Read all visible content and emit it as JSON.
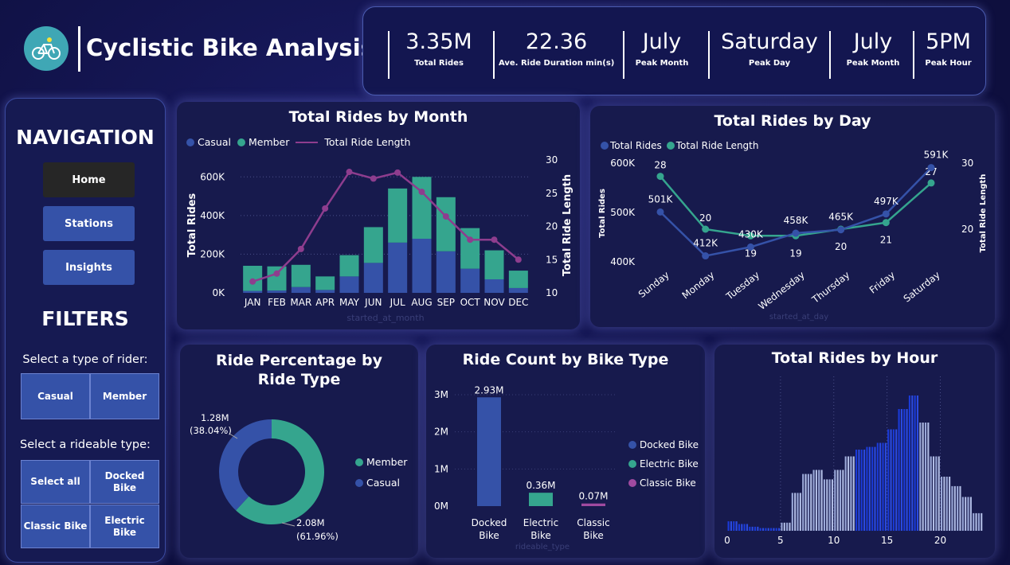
{
  "header": {
    "title": "Cyclistic Bike Analysis",
    "kpis": [
      {
        "value": "3.35M",
        "label": "Total Rides"
      },
      {
        "value": "22.36",
        "label": "Ave. Ride Duration min(s)"
      },
      {
        "value": "July",
        "label": "Peak Month"
      },
      {
        "value": "Saturday",
        "label": "Peak Day"
      },
      {
        "value": "July",
        "label": "Peak Month"
      },
      {
        "value": "5PM",
        "label": "Peak Hour"
      }
    ]
  },
  "navigation": {
    "heading": "NAVIGATION",
    "buttons": [
      "Home",
      "Stations",
      "Insights"
    ],
    "active": "Home"
  },
  "filters": {
    "heading": "FILTERS",
    "rider_label": "Select a type of rider:",
    "rider_options": [
      "Casual",
      "Member"
    ],
    "rideable_label": "Select a rideable type:",
    "rideable_options": [
      "Select all",
      "Docked Bike",
      "Classic Bike",
      "Electric Bike"
    ]
  },
  "colors": {
    "casual": "#3552a8",
    "member": "#35a58e",
    "ride_length": "#8e3d8e",
    "classic": "#a04aa0",
    "hour_dark": "#1a3ad8",
    "hour_light": "#9aa8d8"
  },
  "chart_data": [
    {
      "type": "bar",
      "title": "Total Rides by Month",
      "xlabel": "started_at_month",
      "ylabel": "Total Rides",
      "y2label": "Total Ride Length",
      "categories": [
        "JAN",
        "FEB",
        "MAR",
        "APR",
        "MAY",
        "JUN",
        "JUL",
        "AUG",
        "SEP",
        "OCT",
        "NOV",
        "DEC"
      ],
      "series": [
        {
          "name": "Casual",
          "values": [
            10000,
            12000,
            30000,
            15000,
            85000,
            155000,
            260000,
            280000,
            215000,
            125000,
            70000,
            25000
          ]
        },
        {
          "name": "Member",
          "values": [
            130000,
            125000,
            115000,
            70000,
            110000,
            185000,
            280000,
            320000,
            280000,
            210000,
            150000,
            90000
          ]
        },
        {
          "name": "Total Ride Length",
          "values": [
            11.7,
            12.9,
            16.6,
            22.7,
            28.2,
            27.2,
            28.1,
            25.2,
            21.5,
            18.0,
            18.0,
            15.0
          ]
        }
      ],
      "ylim": [
        0,
        700000
      ],
      "y2lim": [
        10,
        30
      ],
      "yticks": [
        "0K",
        "200K",
        "400K",
        "600K"
      ],
      "y2ticks": [
        "10",
        "15",
        "20",
        "25",
        "30"
      ]
    },
    {
      "type": "line",
      "title": "Total Rides by Day",
      "xlabel": "started_at_day",
      "ylabel": "Total Rides",
      "y2label": "Total Ride Length",
      "categories": [
        "Sunday",
        "Monday",
        "Tuesday",
        "Wednesday",
        "Thursday",
        "Friday",
        "Saturday"
      ],
      "series": [
        {
          "name": "Total Rides",
          "values": [
            501000,
            412000,
            430000,
            458000,
            465000,
            497000,
            591000
          ],
          "labels": [
            "501K",
            "412K",
            "430K",
            "458K",
            "465K",
            "497K",
            "591K"
          ]
        },
        {
          "name": "Total Ride Length",
          "values": [
            28,
            20,
            19,
            19,
            20,
            21,
            27
          ],
          "labels": [
            "28",
            "20",
            "19",
            "19",
            "20",
            "21",
            "27"
          ]
        }
      ],
      "ylim": [
        400000,
        600000
      ],
      "yticks": [
        "400K",
        "500K",
        "600K"
      ],
      "y2ticks": [
        "20",
        "30"
      ]
    },
    {
      "type": "pie",
      "title": "Ride Percentage by Ride Type",
      "slices": [
        {
          "name": "Member",
          "value": 2.08,
          "label": "2.08M",
          "pct": "(61.96%)"
        },
        {
          "name": "Casual",
          "value": 1.28,
          "label": "1.28M",
          "pct": "(38.04%)"
        }
      ]
    },
    {
      "type": "bar",
      "title": "Ride Count by Bike Type",
      "xlabel": "rideable_type",
      "categories": [
        "Docked Bike",
        "Electric Bike",
        "Classic Bike"
      ],
      "values": [
        2.93,
        0.36,
        0.07
      ],
      "labels": [
        "2.93M",
        "0.36M",
        "0.07M"
      ],
      "legend": [
        "Docked Bike",
        "Electric Bike",
        "Classic Bike"
      ],
      "yticks": [
        "0M",
        "1M",
        "2M",
        "3M"
      ],
      "ylim": [
        0,
        3.2
      ]
    },
    {
      "type": "area",
      "title": "Total Rides by Hour",
      "x": [
        0,
        1,
        2,
        3,
        4,
        5,
        6,
        7,
        8,
        9,
        10,
        11,
        12,
        13,
        14,
        15,
        16,
        17,
        18,
        19,
        20,
        21,
        22,
        23
      ],
      "values": [
        0.07,
        0.05,
        0.03,
        0.02,
        0.02,
        0.06,
        0.28,
        0.42,
        0.45,
        0.38,
        0.45,
        0.55,
        0.6,
        0.62,
        0.65,
        0.75,
        0.9,
        1.0,
        0.8,
        0.55,
        0.4,
        0.33,
        0.25,
        0.13
      ],
      "xticks": [
        "0",
        "5",
        "10",
        "15",
        "20"
      ]
    }
  ]
}
